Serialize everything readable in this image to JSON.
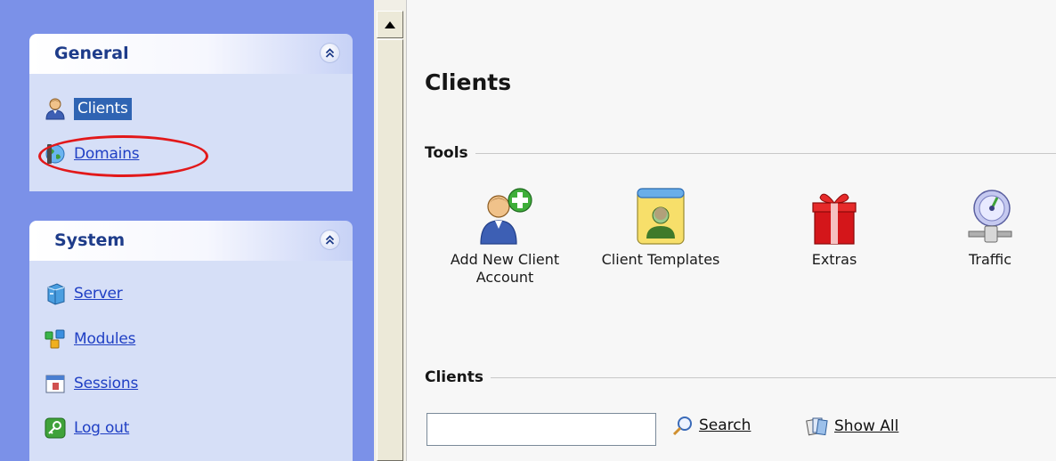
{
  "sidebar": {
    "general": {
      "title": "General",
      "items": [
        {
          "label": "Clients",
          "icon": "client-user-icon",
          "selected": true
        },
        {
          "label": "Domains",
          "icon": "domains-globe-icon",
          "selected": false
        }
      ]
    },
    "system": {
      "title": "System",
      "items": [
        {
          "label": "Server",
          "icon": "server-box-icon"
        },
        {
          "label": "Modules",
          "icon": "modules-icon"
        },
        {
          "label": "Sessions",
          "icon": "sessions-calendar-icon"
        },
        {
          "label": "Log out",
          "icon": "logout-key-icon"
        }
      ]
    }
  },
  "main": {
    "title": "Clients",
    "tools": {
      "title": "Tools",
      "items": [
        {
          "label": "Add New Client\nAccount",
          "icon": "add-client-icon"
        },
        {
          "label": "Client Templates",
          "icon": "client-templates-icon"
        },
        {
          "label": "Extras",
          "icon": "gift-icon"
        },
        {
          "label": "Traffic",
          "icon": "traffic-gauge-icon"
        }
      ]
    },
    "clients": {
      "title": "Clients",
      "search_value": "",
      "search_label": "Search",
      "show_all_label": "Show All"
    }
  },
  "colors": {
    "sidebar_bg": "#7b91e8",
    "panel_body_bg": "#d6dff7",
    "panel_title": "#1e3c8a",
    "link": "#1f3fc4",
    "selected_bg": "#2f64b3",
    "annotation_red": "#e2181a"
  }
}
